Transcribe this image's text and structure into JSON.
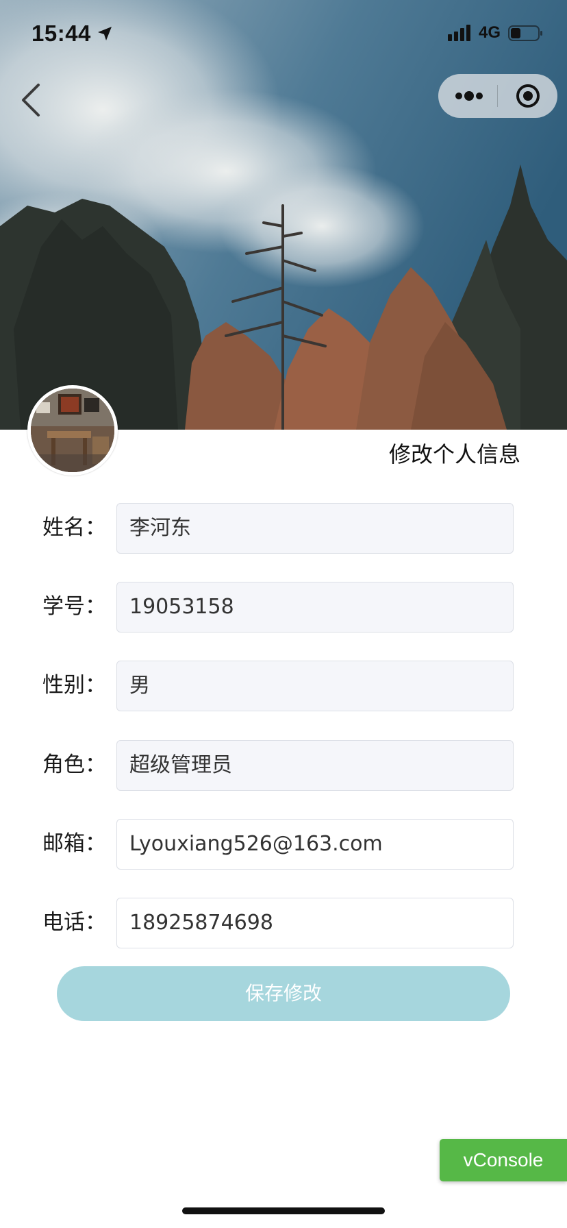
{
  "status_bar": {
    "time": "15:44",
    "network": "4G"
  },
  "nav": {
    "back_icon": "chevron-left-icon",
    "more_icon": "more-dots-icon",
    "close_icon": "target-circle-icon"
  },
  "header": {
    "title": "修改个人信息",
    "cover_image": "forest-sky-photo",
    "avatar_image": "room-interior-photo"
  },
  "form": {
    "fields": [
      {
        "label": "姓名：",
        "value": "李河东",
        "editable": false
      },
      {
        "label": "学号：",
        "value": "19053158",
        "editable": false
      },
      {
        "label": "性别：",
        "value": "男",
        "editable": false
      },
      {
        "label": "角色：",
        "value": "超级管理员",
        "editable": false
      },
      {
        "label": "邮箱：",
        "value": "Lyouxiang526@163.com",
        "editable": true
      },
      {
        "label": "电话：",
        "value": "18925874698",
        "editable": true
      }
    ],
    "save_label": "保存修改"
  },
  "vconsole": {
    "label": "vConsole"
  },
  "colors": {
    "save_button": "#a6d6dd",
    "vconsole": "#56b847",
    "readonly_field_bg": "#f5f6fa"
  }
}
